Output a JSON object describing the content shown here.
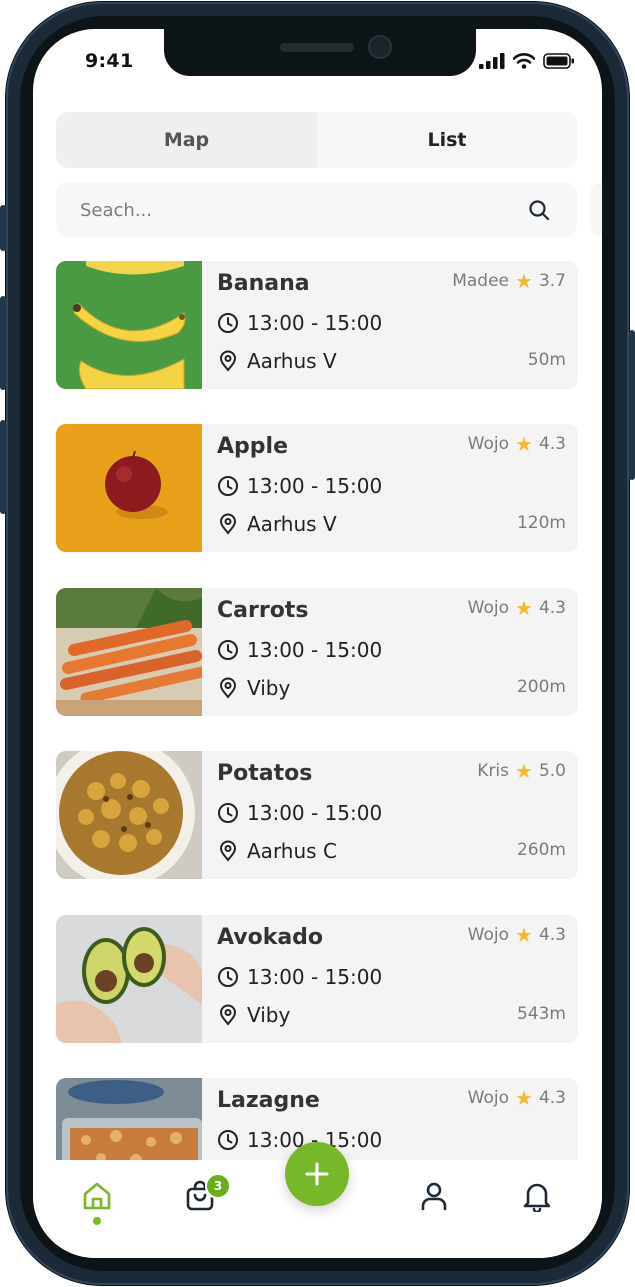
{
  "status_bar": {
    "time": "9:41"
  },
  "segment": {
    "tabs": [
      {
        "label": "Map",
        "active": false
      },
      {
        "label": "List",
        "active": true
      }
    ]
  },
  "search": {
    "placeholder": "Seach...",
    "value": ""
  },
  "listings": [
    {
      "title": "Banana",
      "seller": "Madee",
      "rating": "3.7",
      "time": "13:00 - 15:00",
      "location": "Aarhus V",
      "distance": "50m",
      "image": "banana-image"
    },
    {
      "title": "Apple",
      "seller": "Wojo",
      "rating": "4.3",
      "time": "13:00 - 15:00",
      "location": "Aarhus V",
      "distance": "120m",
      "image": "apple-image"
    },
    {
      "title": "Carrots",
      "seller": "Wojo",
      "rating": "4.3",
      "time": "13:00 - 15:00",
      "location": "Viby",
      "distance": "200m",
      "image": "carrots-image"
    },
    {
      "title": "Potatos",
      "seller": "Kris",
      "rating": "5.0",
      "time": "13:00 - 15:00",
      "location": "Aarhus C",
      "distance": "260m",
      "image": "potatoes-image"
    },
    {
      "title": "Avokado",
      "seller": "Wojo",
      "rating": "4.3",
      "time": "13:00 - 15:00",
      "location": "Viby",
      "distance": "543m",
      "image": "avocado-image"
    },
    {
      "title": "Lazagne",
      "seller": "Wojo",
      "rating": "4.3",
      "time": "13:00 - 15:00",
      "location": "",
      "distance": "",
      "image": "lasagne-image"
    }
  ],
  "nav": {
    "items": [
      "home-icon",
      "bag-icon",
      "add-icon",
      "profile-icon",
      "bell-icon"
    ],
    "active": "home-icon",
    "bag_badge": "3"
  },
  "colors": {
    "accent": "#76b82a",
    "star": "#f5b82e",
    "card_bg": "#f4f4f4",
    "frame": "#1b2a36"
  }
}
